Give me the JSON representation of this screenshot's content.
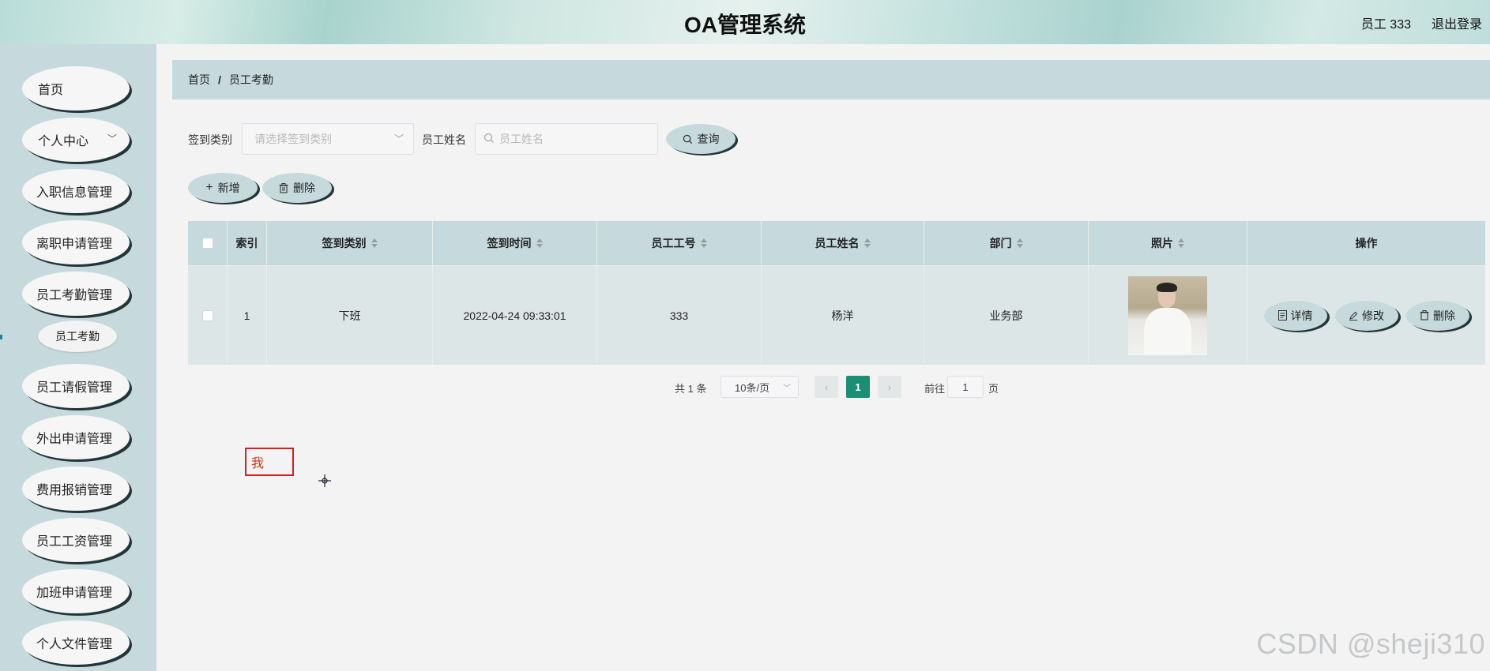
{
  "header": {
    "title": "OA管理系统",
    "user": "员工 333",
    "logout": "退出登录"
  },
  "sidebar": {
    "items": [
      {
        "label": "首页"
      },
      {
        "label": "个人中心"
      },
      {
        "label": "入职信息管理"
      },
      {
        "label": "离职申请管理"
      },
      {
        "label": "员工考勤管理"
      },
      {
        "label": "员工请假管理"
      },
      {
        "label": "外出申请管理"
      },
      {
        "label": "费用报销管理"
      },
      {
        "label": "员工工资管理"
      },
      {
        "label": "加班申请管理"
      },
      {
        "label": "个人文件管理"
      }
    ],
    "sub_item": "员工考勤"
  },
  "breadcrumb": {
    "home": "首页",
    "separator": "/",
    "current": "员工考勤"
  },
  "search": {
    "category_label": "签到类别",
    "category_placeholder": "请选择签到类别",
    "name_label": "员工姓名",
    "name_placeholder": "员工姓名",
    "query_button": "查询"
  },
  "toolbar": {
    "add_button": "新增",
    "delete_button": "删除"
  },
  "table": {
    "headers": [
      "索引",
      "签到类别",
      "签到时间",
      "员工工号",
      "员工姓名",
      "部门",
      "照片",
      "操作"
    ],
    "rows": [
      {
        "index": "1",
        "category": "下班",
        "time": "2022-04-24 09:33:01",
        "emp_no": "333",
        "emp_name": "杨洋",
        "dept": "业务部"
      }
    ],
    "actions": {
      "detail": "详情",
      "edit": "修改",
      "delete": "删除"
    }
  },
  "pagination": {
    "total": "共 1 条",
    "page_size": "10条/页",
    "current_page": "1",
    "goto_label": "前往",
    "goto_value": "1",
    "page_suffix": "页"
  },
  "overlay": {
    "ime_text": "我"
  },
  "watermark": "CSDN @sheji310",
  "colors": {
    "accent": "#c6dadd",
    "active_page": "#1a8f73",
    "shadow": "#22363a"
  }
}
